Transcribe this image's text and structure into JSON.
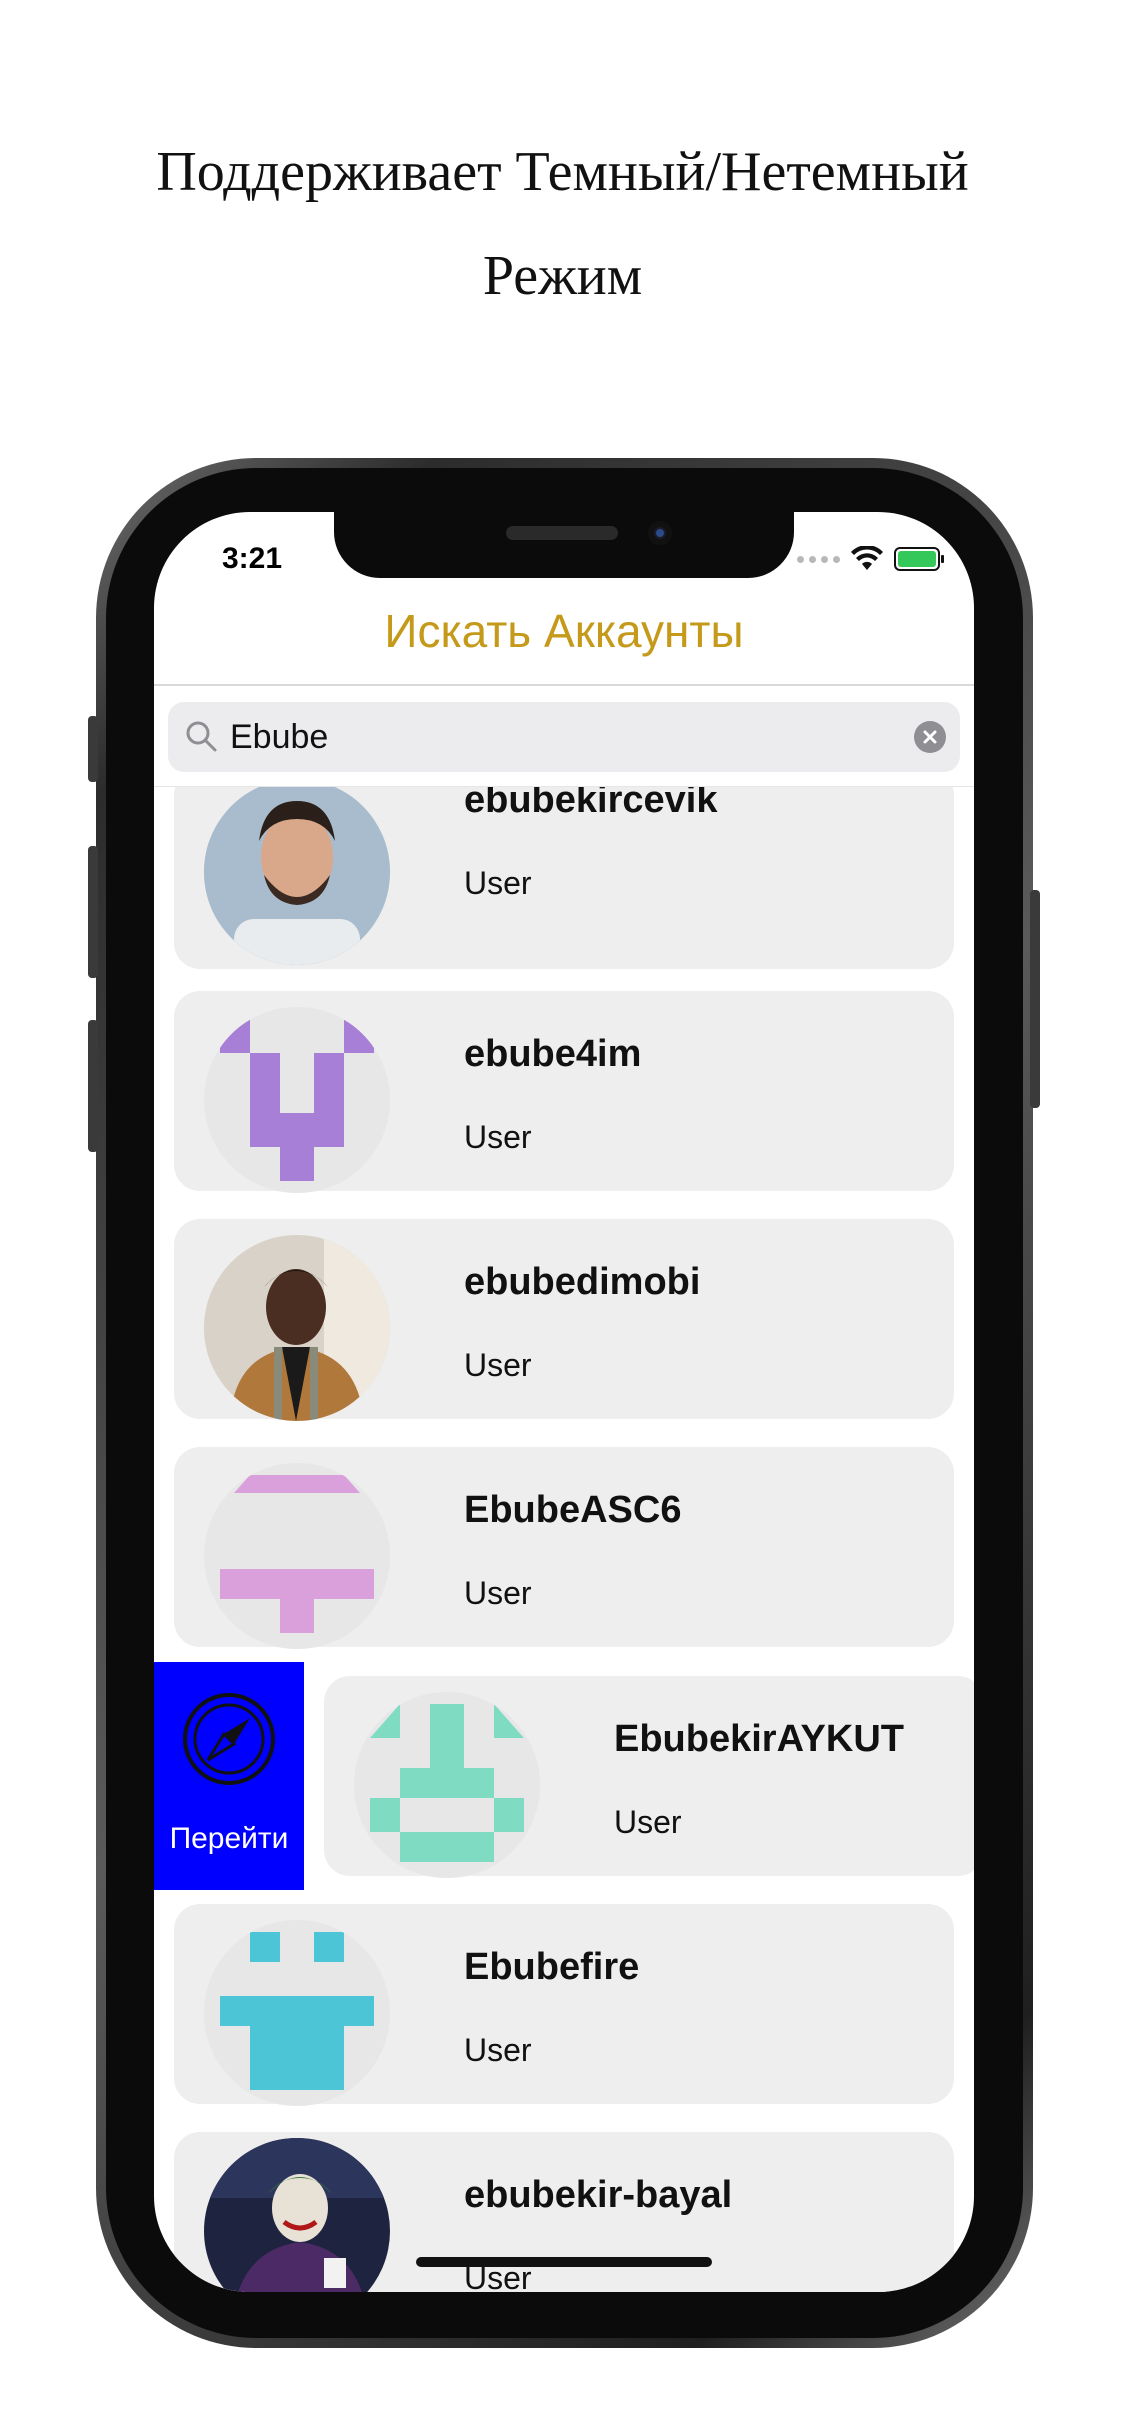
{
  "headline": {
    "line1": "Поддерживает Темный/Нетемный",
    "line2": "Режим"
  },
  "status_bar": {
    "time": "3:21"
  },
  "nav": {
    "title": "Искать Аккаунты"
  },
  "search": {
    "value": "Ebube",
    "placeholder": ""
  },
  "swipe_action": {
    "label": "Перейти",
    "icon": "compass-icon",
    "color": "#0000ff"
  },
  "accounts": [
    {
      "username": "ebubekircevik",
      "role": "User",
      "avatar": "photo"
    },
    {
      "username": "ebube4im",
      "role": "User",
      "avatar": "identicon",
      "color": "#a77fd6"
    },
    {
      "username": "ebubedimobi",
      "role": "User",
      "avatar": "photo"
    },
    {
      "username": "EbubeASC6",
      "role": "User",
      "avatar": "identicon",
      "color": "#d9a0dc"
    },
    {
      "username": "EbubekirAYKUT",
      "role": "User",
      "avatar": "identicon",
      "color": "#7fdcc3"
    },
    {
      "username": "Ebubefire",
      "role": "User",
      "avatar": "identicon",
      "color": "#4cc6d6"
    },
    {
      "username": "ebubekir-bayal",
      "role": "User",
      "avatar": "photo"
    }
  ],
  "colors": {
    "accent": "#c59a1a",
    "card": "#eeeeee"
  }
}
